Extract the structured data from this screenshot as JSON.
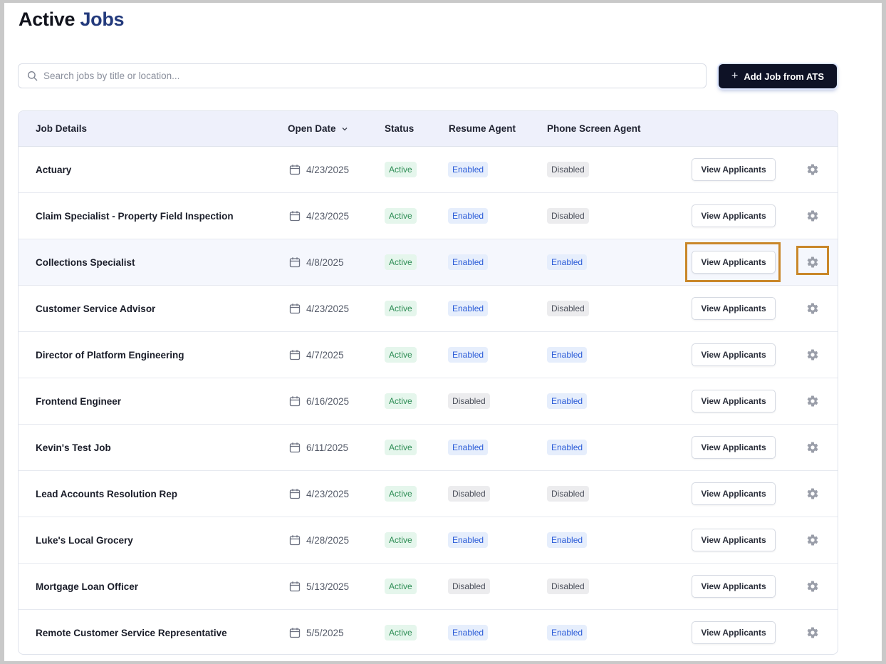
{
  "page": {
    "title_part1": "Active",
    "title_part2": "Jobs"
  },
  "search": {
    "placeholder": "Search jobs by title or location...",
    "value": ""
  },
  "toolbar": {
    "add_label": "Add Job from ATS"
  },
  "table": {
    "headers": {
      "job_details": "Job Details",
      "open_date": "Open Date",
      "status": "Status",
      "resume_agent": "Resume Agent",
      "phone_agent": "Phone Screen Agent"
    },
    "view_label": "View Applicants",
    "rows": [
      {
        "title": "Actuary",
        "date": "4/23/2025",
        "status": "Active",
        "resume": "Enabled",
        "phone": "Disabled"
      },
      {
        "title": "Claim Specialist - Property Field Inspection",
        "date": "4/23/2025",
        "status": "Active",
        "resume": "Enabled",
        "phone": "Disabled"
      },
      {
        "title": "Collections Specialist",
        "date": "4/8/2025",
        "status": "Active",
        "resume": "Enabled",
        "phone": "Enabled"
      },
      {
        "title": "Customer Service Advisor",
        "date": "4/23/2025",
        "status": "Active",
        "resume": "Enabled",
        "phone": "Disabled"
      },
      {
        "title": "Director of Platform Engineering",
        "date": "4/7/2025",
        "status": "Active",
        "resume": "Enabled",
        "phone": "Enabled"
      },
      {
        "title": "Frontend Engineer",
        "date": "6/16/2025",
        "status": "Active",
        "resume": "Disabled",
        "phone": "Enabled"
      },
      {
        "title": "Kevin's Test Job",
        "date": "6/11/2025",
        "status": "Active",
        "resume": "Enabled",
        "phone": "Enabled"
      },
      {
        "title": "Lead Accounts Resolution Rep",
        "date": "4/23/2025",
        "status": "Active",
        "resume": "Disabled",
        "phone": "Disabled"
      },
      {
        "title": "Luke's Local Grocery",
        "date": "4/28/2025",
        "status": "Active",
        "resume": "Enabled",
        "phone": "Enabled"
      },
      {
        "title": "Mortgage Loan Officer",
        "date": "5/13/2025",
        "status": "Active",
        "resume": "Disabled",
        "phone": "Disabled"
      },
      {
        "title": "Remote Customer Service Representative",
        "date": "5/5/2025",
        "status": "Active",
        "resume": "Enabled",
        "phone": "Enabled"
      }
    ]
  },
  "colors": {
    "accent_title": "#233a7c",
    "primary_button": "#0e1226",
    "highlight_outline": "#c9872a"
  }
}
